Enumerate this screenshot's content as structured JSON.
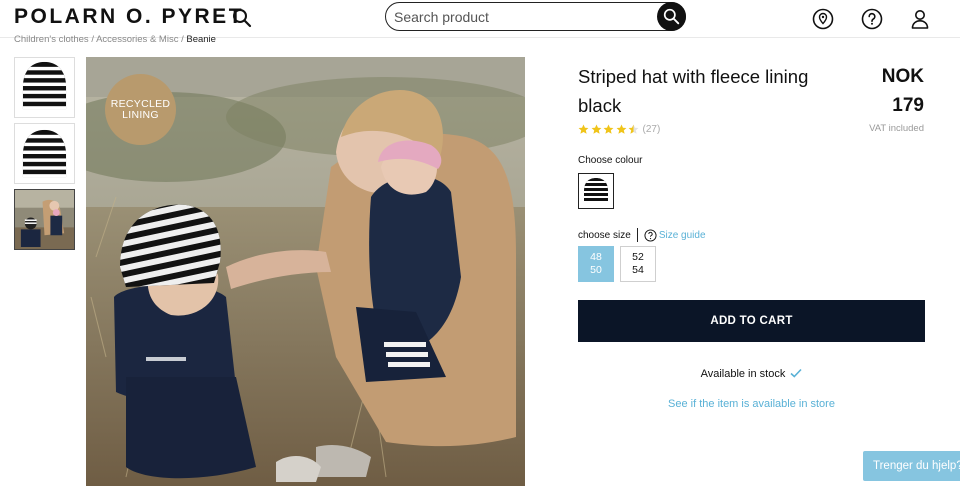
{
  "header": {
    "logo": "POLARN O. PYRET",
    "search_placeholder": "Search product",
    "icons": [
      "search-icon",
      "location-pin-icon",
      "help-icon",
      "account-icon"
    ]
  },
  "breadcrumb": {
    "items": [
      "Children's clothes",
      "Accessories & Misc",
      "Beanie"
    ],
    "separator": "/"
  },
  "gallery": {
    "thumbnails": [
      "striped-beanie",
      "striped-beanie-alt",
      "lifestyle-photo"
    ],
    "badge": "RECYCLED\nLINING"
  },
  "product": {
    "title": "Striped hat with fleece lining black",
    "currency": "NOK",
    "price": "179",
    "vat_note": "VAT included",
    "rating": 4.5,
    "review_count": "(27)",
    "colour_label": "Choose colour",
    "size_label": "choose size",
    "size_guide": "Size guide",
    "sizes": [
      {
        "line1": "48",
        "line2": "50",
        "selected": true
      },
      {
        "line1": "52",
        "line2": "54",
        "selected": false
      }
    ],
    "add_to_cart": "ADD TO CART",
    "stock": "Available in stock",
    "store_link": "See if the item is available in store"
  },
  "help": {
    "label": "Trenger du hjelp?"
  },
  "colors": {
    "accent": "#59b1d6",
    "selected_size": "#86c5e0",
    "cart_button": "#0b1527",
    "badge": "#b89a6d",
    "stars": "#f0c419"
  }
}
